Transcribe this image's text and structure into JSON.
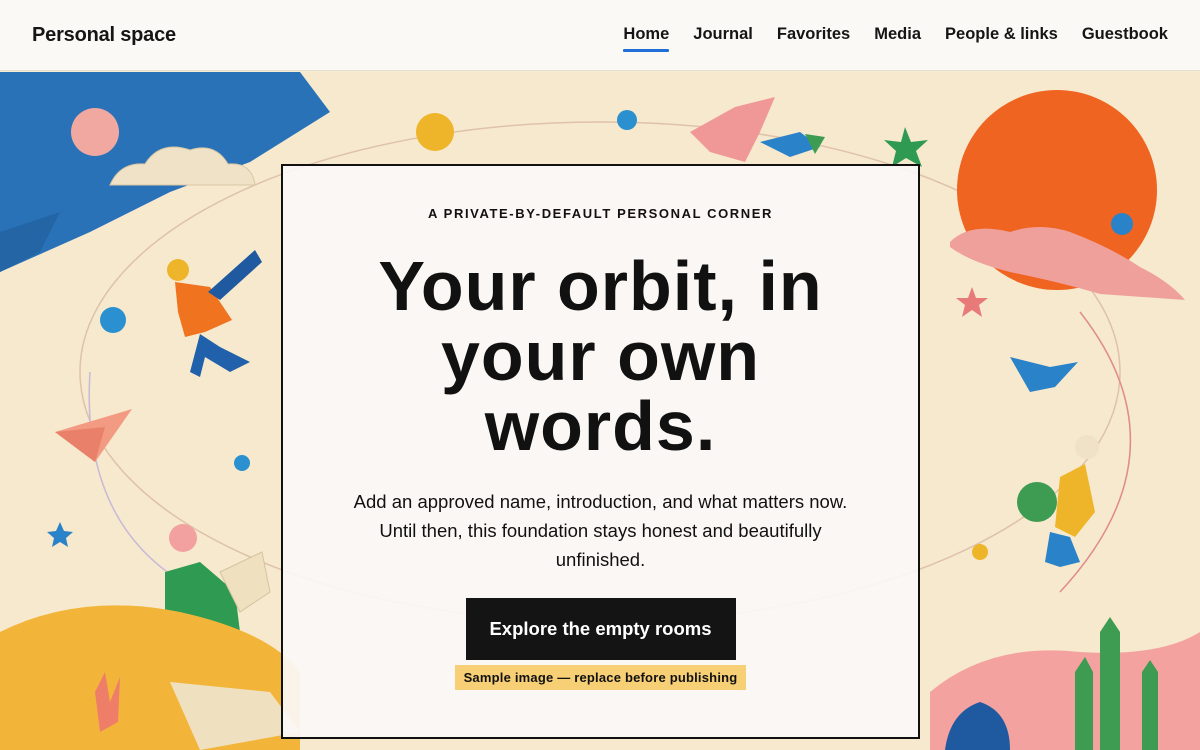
{
  "site": {
    "brand": "Personal space"
  },
  "nav": {
    "items": [
      {
        "label": "Home",
        "active": true
      },
      {
        "label": "Journal",
        "active": false
      },
      {
        "label": "Favorites",
        "active": false
      },
      {
        "label": "Media",
        "active": false
      },
      {
        "label": "People & links",
        "active": false
      },
      {
        "label": "Guestbook",
        "active": false
      }
    ]
  },
  "hero": {
    "eyebrow": "A PRIVATE-BY-DEFAULT PERSONAL CORNER",
    "headline": "Your orbit, in your own words.",
    "intro": "Add an approved name, introduction, and what matters now. Until then, this foundation stays honest and beautifully unfinished.",
    "cta_label": "Explore the empty rooms",
    "sample_note": "Sample image — replace before publishing"
  },
  "colors": {
    "accent": "#1f6fd6",
    "note_bg": "#f7cf74",
    "button_bg": "#141414"
  }
}
